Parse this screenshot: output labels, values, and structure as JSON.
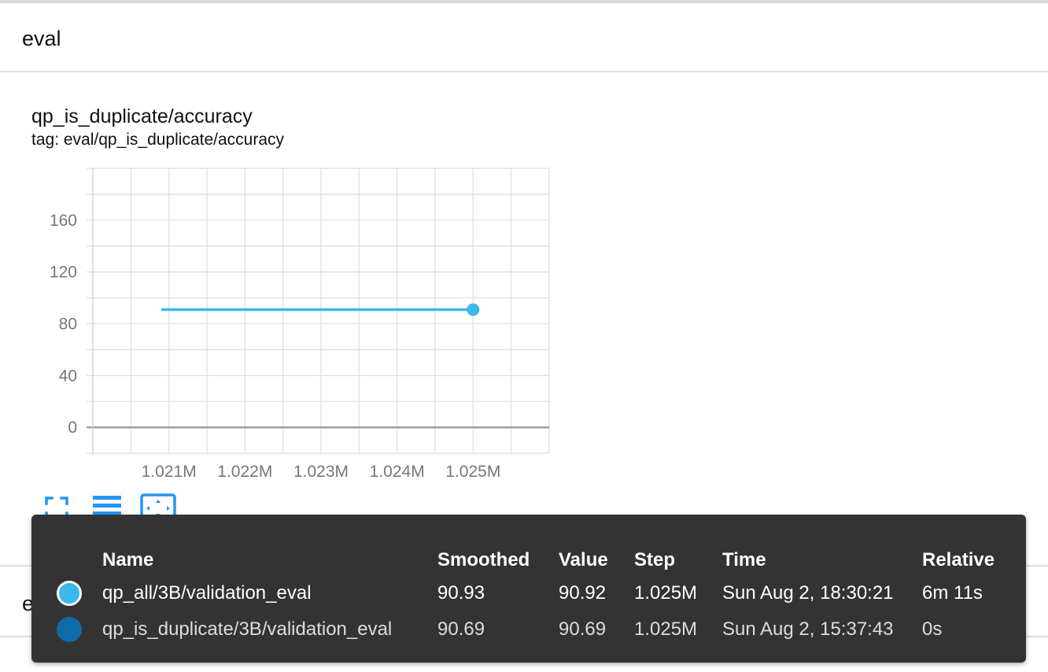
{
  "section": {
    "title": "eval"
  },
  "card": {
    "title": "qp_is_duplicate/accuracy",
    "tag": "tag: eval/qp_is_duplicate/accuracy"
  },
  "chart_data": {
    "type": "line",
    "title": "qp_is_duplicate/accuracy",
    "xlabel": "",
    "ylabel": "",
    "x_ticks": [
      "1.021M",
      "1.022M",
      "1.023M",
      "1.024M",
      "1.025M"
    ],
    "y_ticks": [
      "0",
      "40",
      "80",
      "120",
      "160"
    ],
    "xlim": [
      1020000,
      1026000
    ],
    "ylim": [
      -20,
      200
    ],
    "grid": true,
    "series": [
      {
        "name": "qp_all/3B/validation_eval",
        "color": "#3bb8ec",
        "x": [
          1020900,
          1025000
        ],
        "y": [
          90.93,
          90.93
        ],
        "highlight_point": {
          "x": 1025000,
          "y": 90.92
        }
      }
    ]
  },
  "icons": {
    "fullscreen": "fullscreen-icon",
    "lines": "toggle-log-scale-icon",
    "fit": "fit-domain-icon"
  },
  "section2": {
    "title": "examples"
  },
  "tooltip": {
    "headers": {
      "name": "Name",
      "smoothed": "Smoothed",
      "value": "Value",
      "step": "Step",
      "time": "Time",
      "relative": "Relative"
    },
    "rows": [
      {
        "color": "#3bb8ec",
        "name": "qp_all/3B/validation_eval",
        "smoothed": "90.93",
        "value": "90.92",
        "step": "1.025M",
        "time": "Sun Aug 2, 18:30:21",
        "relative": "6m 11s"
      },
      {
        "color": "#0f6aa8",
        "name": "qp_is_duplicate/3B/validation_eval",
        "smoothed": "90.69",
        "value": "90.69",
        "step": "1.025M",
        "time": "Sun Aug 2, 15:37:43",
        "relative": "0s"
      }
    ]
  }
}
